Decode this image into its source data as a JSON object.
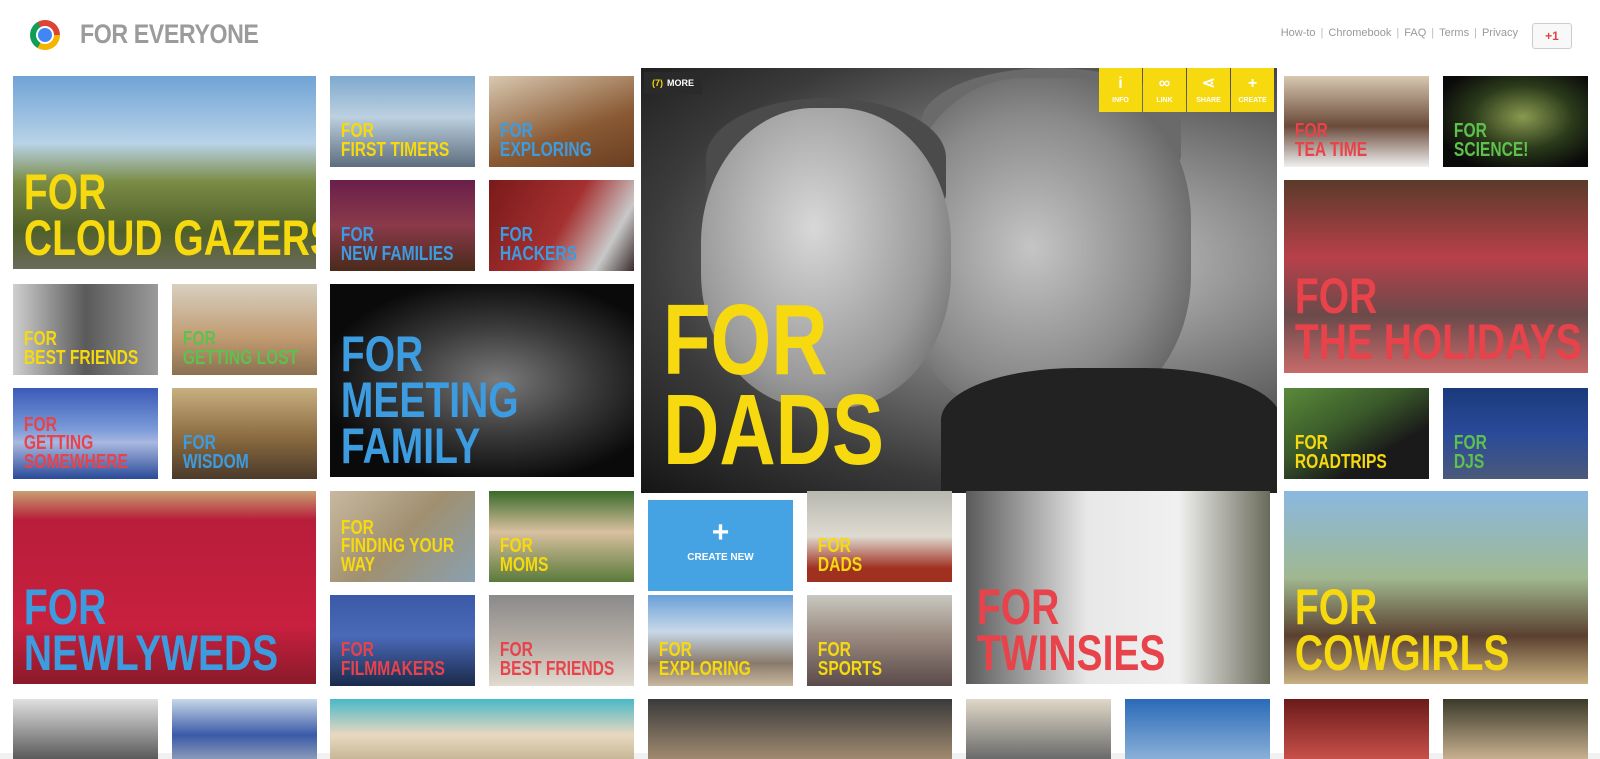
{
  "header": {
    "brand": "FOR EVERYONE",
    "links": [
      "How-to",
      "Chromebook",
      "FAQ",
      "Terms",
      "Privacy"
    ],
    "plusone": "+1"
  },
  "feature": {
    "more_count": "(7)",
    "more_label": "MORE",
    "caption": "FOR\nDADS",
    "actions": [
      {
        "icon": "info-icon",
        "glyph": "i",
        "label": "INFO"
      },
      {
        "icon": "link-icon",
        "glyph": "∞",
        "label": "LINK"
      },
      {
        "icon": "share-icon",
        "glyph": "⋖",
        "label": "SHARE"
      },
      {
        "icon": "plus-icon",
        "glyph": "+",
        "label": "CREATE"
      }
    ]
  },
  "create_new": {
    "glyph": "+",
    "label": "CREATE NEW"
  },
  "tiles": [
    {
      "id": "cloud-gazers",
      "text": "FOR\nCLOUD GAZERS",
      "color": "y",
      "bg": "linear-gradient(180deg,#6fa3d6 0%,#b9d3e8 35%,#7a8b45 55%,#4f5f2a 80%,#6b6b5a 100%)"
    },
    {
      "id": "first-timers",
      "text": "FOR\nFIRST TIMERS",
      "color": "y",
      "bg": "linear-gradient(180deg,#7fa9cf 0%,#bcd0e0 45%,#5d6d7d 100%)"
    },
    {
      "id": "exploring-dog",
      "text": "FOR\nEXPLORING",
      "color": "b",
      "bg": "linear-gradient(160deg,#d8c8b0 0%,#8a5a34 60%,#6a3e22 100%)"
    },
    {
      "id": "new-families",
      "text": "FOR\nNEW FAMILIES",
      "color": "b",
      "bg": "linear-gradient(180deg,#6a1f4a 0%,#8a3a4a 50%,#4a2a1a 100%)"
    },
    {
      "id": "hackers",
      "text": "FOR\nHACKERS",
      "color": "b",
      "bg": "linear-gradient(120deg,#7a1a1a 0%,#a53030 50%,#c8c8c8 80%,#3a2a2a 100%)"
    },
    {
      "id": "best-friends-1",
      "text": "FOR\nBEST FRIENDS",
      "color": "y",
      "bg": "linear-gradient(90deg,#cfcfcf 0%,#5a5a5a 50%,#9a9a9a 100%)"
    },
    {
      "id": "getting-lost",
      "text": "FOR\nGETTING LOST",
      "color": "g",
      "bg": "linear-gradient(180deg,#d8d0c0 0%,#c09a70 60%,#8a7050 100%)"
    },
    {
      "id": "meeting-family",
      "text": "FOR\nMEETING\nFAMILY",
      "color": "b",
      "bg": "radial-gradient(ellipse at 55% 50%,#7a7a7a 0,#3a3a3a 40%,#0a0a0a 75%)"
    },
    {
      "id": "getting-somewhere",
      "text": "FOR\nGETTING\nSOMEWHERE",
      "color": "r",
      "bg": "linear-gradient(180deg,#3a5ab8 0%,#7a9ad8 45%,#a9b8e0 60%,#2a4a98 100%)"
    },
    {
      "id": "wisdom",
      "text": "FOR\nWISDOM",
      "color": "b",
      "bg": "linear-gradient(180deg,#c8b080 0%,#8a6a40 55%,#4a3a2a 100%)"
    },
    {
      "id": "tea-time",
      "text": "FOR\nTEA TIME",
      "color": "r",
      "bg": "linear-gradient(180deg,#d8c8b0 0%,#6a4a3a 55%,#f0f0f0 100%)"
    },
    {
      "id": "science",
      "text": "FOR\nSCIENCE!",
      "color": "g",
      "bg": "radial-gradient(ellipse at 55% 45%,#8a9a50 0,#2a3a1a 45%,#0a0a0a 80%)"
    },
    {
      "id": "the-holidays",
      "text": "FOR\nTHE HOLIDAYS",
      "color": "r",
      "bg": "linear-gradient(180deg,#5a3a2a 0%,#b8404a 40%,#6a4a4a 70%,#c86a6a 100%)"
    },
    {
      "id": "roadtrips",
      "text": "FOR\nROADTRIPS",
      "color": "y",
      "bg": "linear-gradient(150deg,#5a8a3a 0%,#3a5a2a 40%,#1a1a1a 70%)"
    },
    {
      "id": "djs",
      "text": "FOR\nDJS",
      "color": "g",
      "bg": "linear-gradient(180deg,#1a3a7a 0%,#2a4a9a 50%,#4a5a7a 100%)"
    },
    {
      "id": "newlyweds",
      "text": "FOR\nNEWLYWEDS",
      "color": "b",
      "bg": "linear-gradient(180deg,#c8a070 0%,#b81e3a 15%,#c8203e 70%,#8a1a2a 100%)"
    },
    {
      "id": "finding-your-way",
      "text": "FOR\nFINDING YOUR\nWAY",
      "color": "y",
      "bg": "linear-gradient(135deg,#c8b8a0 0%,#a09070 50%,#8aa0b0 100%)"
    },
    {
      "id": "moms",
      "text": "FOR\nMOMS",
      "color": "y",
      "bg": "linear-gradient(180deg,#3a6a2a 0%,#d8c0a0 45%,#5a7a3a 100%)"
    },
    {
      "id": "dads-small",
      "text": "FOR\nDADS",
      "color": "y",
      "bg": "linear-gradient(180deg,#b8b8b0 0%,#dedad0 50%,#a03020 85%)"
    },
    {
      "id": "twinsies",
      "text": "FOR\nTWINSIES",
      "color": "r",
      "bg": "linear-gradient(90deg,#5a5a5a 0%,#e8e8e8 40%,#f0f0f0 70%,#6a6a5a 100%)"
    },
    {
      "id": "cowgirls",
      "text": "FOR\nCOWGIRLS",
      "color": "y",
      "bg": "linear-gradient(180deg,#8ab8e0 0%,#a0b890 45%,#5a4030 75%,#c8b080 100%)"
    },
    {
      "id": "filmmakers",
      "text": "FOR\nFILMMAKERS",
      "color": "r",
      "bg": "linear-gradient(180deg,#3a5aa8 0%,#4a6ab8 45%,#1a2a4a 100%)"
    },
    {
      "id": "best-friends-2",
      "text": "FOR\nBEST FRIENDS",
      "color": "r",
      "bg": "linear-gradient(180deg,#8a8a8a 0%,#b8b0a8 55%,#e0dad0 100%)"
    },
    {
      "id": "exploring-beach",
      "text": "FOR\nEXPLORING",
      "color": "y",
      "bg": "linear-gradient(180deg,#6aa0d8 0%,#c8d8e8 40%,#8a7a6a 75%,#c8b8a0 100%)"
    },
    {
      "id": "sports",
      "text": "FOR\nSPORTS",
      "color": "y",
      "bg": "linear-gradient(180deg,#c8c8c0 0%,#9a8a80 45%,#5a4a4a 100%)"
    },
    {
      "id": "row5-1",
      "text": "",
      "color": "y",
      "bg": "linear-gradient(180deg,#e0e0e0 0%,#5a5a5a 100%)"
    },
    {
      "id": "row5-2",
      "text": "",
      "color": "y",
      "bg": "linear-gradient(180deg,#c8d8e8 0%,#3a5aa8 60%,#8a9ab8 100%)"
    },
    {
      "id": "row5-3",
      "text": "",
      "color": "y",
      "bg": "linear-gradient(180deg,#4ab8c8 0%,#e8d8c0 60%,#c8b898 100%)"
    },
    {
      "id": "row5-4",
      "text": "",
      "color": "y",
      "bg": "linear-gradient(180deg,#3a3a3a 0%,#a08a70 100%)"
    },
    {
      "id": "row5-5",
      "text": "",
      "color": "y",
      "bg": "linear-gradient(180deg,#e0d8c8 0%,#6a6a6a 100%)"
    },
    {
      "id": "row5-6",
      "text": "",
      "color": "y",
      "bg": "linear-gradient(180deg,#2a6ab8 0%,#8ab0d8 100%)"
    },
    {
      "id": "row5-7",
      "text": "",
      "color": "y",
      "bg": "linear-gradient(180deg,#6a1a1a 0%,#c8504a 100%)"
    },
    {
      "id": "row5-8",
      "text": "",
      "color": "y",
      "bg": "linear-gradient(180deg,#3a3a2a 0%,#c8b090 100%)"
    }
  ]
}
